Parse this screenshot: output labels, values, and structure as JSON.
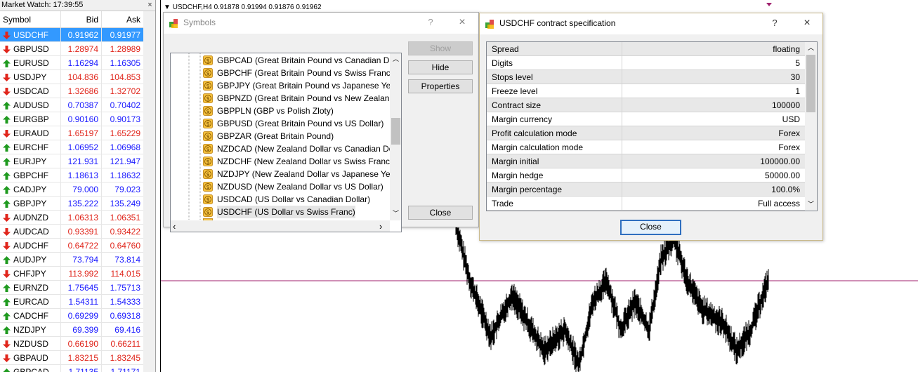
{
  "market_watch": {
    "title": "Market Watch: 17:39:55",
    "close_glyph": "×",
    "columns": {
      "symbol": "Symbol",
      "bid": "Bid",
      "ask": "Ask"
    },
    "rows": [
      {
        "symbol": "USDCHF",
        "bid": "0.91962",
        "ask": "0.91977",
        "dir": "down",
        "color": "red",
        "selected": true
      },
      {
        "symbol": "GBPUSD",
        "bid": "1.28974",
        "ask": "1.28989",
        "dir": "down",
        "color": "red"
      },
      {
        "symbol": "EURUSD",
        "bid": "1.16294",
        "ask": "1.16305",
        "dir": "up",
        "color": "blue"
      },
      {
        "symbol": "USDJPY",
        "bid": "104.836",
        "ask": "104.853",
        "dir": "down",
        "color": "red"
      },
      {
        "symbol": "USDCAD",
        "bid": "1.32686",
        "ask": "1.32702",
        "dir": "down",
        "color": "red"
      },
      {
        "symbol": "AUDUSD",
        "bid": "0.70387",
        "ask": "0.70402",
        "dir": "up",
        "color": "blue"
      },
      {
        "symbol": "EURGBP",
        "bid": "0.90160",
        "ask": "0.90173",
        "dir": "up",
        "color": "blue"
      },
      {
        "symbol": "EURAUD",
        "bid": "1.65197",
        "ask": "1.65229",
        "dir": "down",
        "color": "red"
      },
      {
        "symbol": "EURCHF",
        "bid": "1.06952",
        "ask": "1.06968",
        "dir": "up",
        "color": "blue"
      },
      {
        "symbol": "EURJPY",
        "bid": "121.931",
        "ask": "121.947",
        "dir": "up",
        "color": "blue"
      },
      {
        "symbol": "GBPCHF",
        "bid": "1.18613",
        "ask": "1.18632",
        "dir": "up",
        "color": "blue"
      },
      {
        "symbol": "CADJPY",
        "bid": "79.000",
        "ask": "79.023",
        "dir": "up",
        "color": "blue"
      },
      {
        "symbol": "GBPJPY",
        "bid": "135.222",
        "ask": "135.249",
        "dir": "up",
        "color": "blue"
      },
      {
        "symbol": "AUDNZD",
        "bid": "1.06313",
        "ask": "1.06351",
        "dir": "down",
        "color": "red"
      },
      {
        "symbol": "AUDCAD",
        "bid": "0.93391",
        "ask": "0.93422",
        "dir": "down",
        "color": "red"
      },
      {
        "symbol": "AUDCHF",
        "bid": "0.64722",
        "ask": "0.64760",
        "dir": "down",
        "color": "red"
      },
      {
        "symbol": "AUDJPY",
        "bid": "73.794",
        "ask": "73.814",
        "dir": "up",
        "color": "blue"
      },
      {
        "symbol": "CHFJPY",
        "bid": "113.992",
        "ask": "114.015",
        "dir": "down",
        "color": "red"
      },
      {
        "symbol": "EURNZD",
        "bid": "1.75645",
        "ask": "1.75713",
        "dir": "up",
        "color": "blue"
      },
      {
        "symbol": "EURCAD",
        "bid": "1.54311",
        "ask": "1.54333",
        "dir": "up",
        "color": "blue"
      },
      {
        "symbol": "CADCHF",
        "bid": "0.69299",
        "ask": "0.69318",
        "dir": "up",
        "color": "blue"
      },
      {
        "symbol": "NZDJPY",
        "bid": "69.399",
        "ask": "69.416",
        "dir": "up",
        "color": "blue"
      },
      {
        "symbol": "NZDUSD",
        "bid": "0.66190",
        "ask": "0.66211",
        "dir": "down",
        "color": "red"
      },
      {
        "symbol": "GBPAUD",
        "bid": "1.83215",
        "ask": "1.83245",
        "dir": "down",
        "color": "red"
      },
      {
        "symbol": "GBPCAD",
        "bid": "1.71135",
        "ask": "1.71171",
        "dir": "up",
        "color": "blue"
      }
    ]
  },
  "chart": {
    "header": "USDCHF,H4  0.91878 0.91994 0.91876 0.91962"
  },
  "symbols_dialog": {
    "title": "Symbols",
    "help": "?",
    "close_glyph": "×",
    "items": [
      {
        "code": "GBPCAD",
        "desc": "(Great Britain Pound vs Canadian Dollar)"
      },
      {
        "code": "GBPCHF",
        "desc": "(Great Britain Pound vs Swiss Franc)"
      },
      {
        "code": "GBPJPY",
        "desc": "(Great Britain Pound vs Japanese Yen)"
      },
      {
        "code": "GBPNZD",
        "desc": "(Great Britain Pound vs New Zealand Dolla"
      },
      {
        "code": "GBPPLN",
        "desc": "(GBP vs Polish Zloty)"
      },
      {
        "code": "GBPUSD",
        "desc": "(Great Britain Pound vs US Dollar)"
      },
      {
        "code": "GBPZAR",
        "desc": "(Great Britain Pound)"
      },
      {
        "code": "NZDCAD",
        "desc": "(New Zealand Dollar vs Canadian Dollar)"
      },
      {
        "code": "NZDCHF",
        "desc": "(New Zealand Dollar vs Swiss Franc)"
      },
      {
        "code": "NZDJPY",
        "desc": "(New Zealand Dollar vs Japanese Yen)"
      },
      {
        "code": "NZDUSD",
        "desc": "(New Zealand Dollar vs US Dollar)"
      },
      {
        "code": "USDCAD",
        "desc": "(US Dollar vs Canadian Dollar)"
      },
      {
        "code": "USDCHF",
        "desc": "(US Dollar vs Swiss Franc)",
        "selected": true
      }
    ],
    "buttons": {
      "show": "Show",
      "hide": "Hide",
      "properties": "Properties",
      "close": "Close"
    }
  },
  "spec_dialog": {
    "title": "USDCHF contract specification",
    "help": "?",
    "close_glyph": "×",
    "rows": [
      {
        "key": "Spread",
        "value": "floating"
      },
      {
        "key": "Digits",
        "value": "5"
      },
      {
        "key": "Stops level",
        "value": "30"
      },
      {
        "key": "Freeze level",
        "value": "1"
      },
      {
        "key": "Contract size",
        "value": "100000"
      },
      {
        "key": "Margin currency",
        "value": "USD"
      },
      {
        "key": "Profit calculation mode",
        "value": "Forex"
      },
      {
        "key": "Margin calculation mode",
        "value": "Forex"
      },
      {
        "key": "Margin initial",
        "value": "100000.00"
      },
      {
        "key": "Margin hedge",
        "value": "50000.00"
      },
      {
        "key": "Margin percentage",
        "value": "100.0%"
      },
      {
        "key": "Trade",
        "value": "Full access"
      }
    ],
    "close_button": "Close"
  },
  "colors": {
    "up": "#1f9a1f",
    "down": "#e0251b",
    "blue_price": "#1a1aff",
    "red_price": "#e0251b",
    "selection": "#3399ff",
    "level_line": "#a0216e"
  }
}
